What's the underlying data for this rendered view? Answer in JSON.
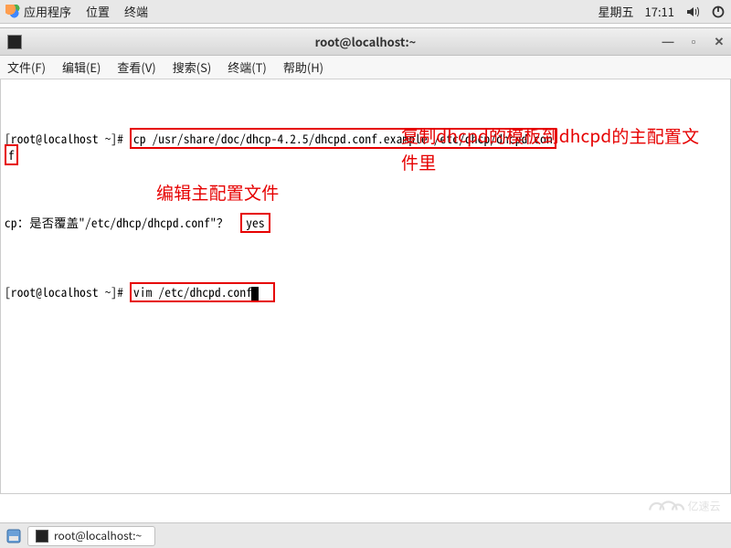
{
  "topPanel": {
    "menu": [
      "应用程序",
      "位置",
      "终端"
    ],
    "day": "星期五",
    "time": "17:11"
  },
  "window": {
    "title": "root@localhost:~"
  },
  "menubar": {
    "items": [
      "文件(F)",
      "编辑(E)",
      "查看(V)",
      "搜索(S)",
      "终端(T)",
      "帮助(H)"
    ]
  },
  "terminal": {
    "prompt": "[root@localhost ~]#",
    "cmd1_part1": "cp /usr/share/doc/dhcp-4.2.5/dhcpd.conf.example /etc/dhcp/dhcpd.con",
    "cmd1_part2": "f",
    "overwrite_prompt": "cp：是否覆盖\"/etc/dhcp/dhcpd.conf\"？",
    "overwrite_answer": "yes",
    "cmd2": "vim /etc/dhcpd.conf"
  },
  "annotations": {
    "right": "复制dhcpd的模板到dhcpd的主配置文件里",
    "below": "编辑主配置文件"
  },
  "taskbar": {
    "item": "root@localhost:~"
  },
  "watermark": "亿速云"
}
